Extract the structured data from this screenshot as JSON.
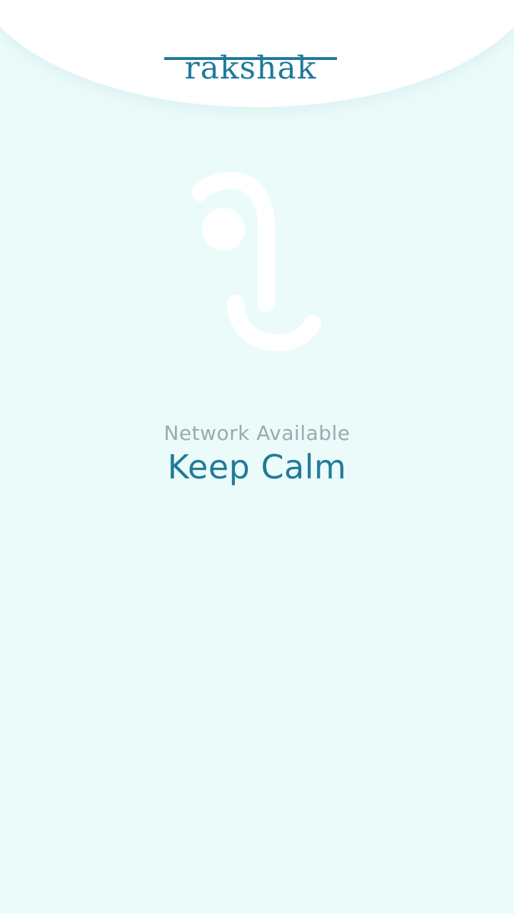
{
  "app": {
    "logo_text": "rakshak"
  },
  "status": {
    "network": "Network Available",
    "message": "Keep Calm"
  },
  "colors": {
    "background": "#eafbfa",
    "header": "#ffffff",
    "brand": "#227a99",
    "muted_text": "#9aaab2",
    "illustration": "#ffffff"
  },
  "icons": {
    "center_illustration": "calm-figure-icon"
  }
}
